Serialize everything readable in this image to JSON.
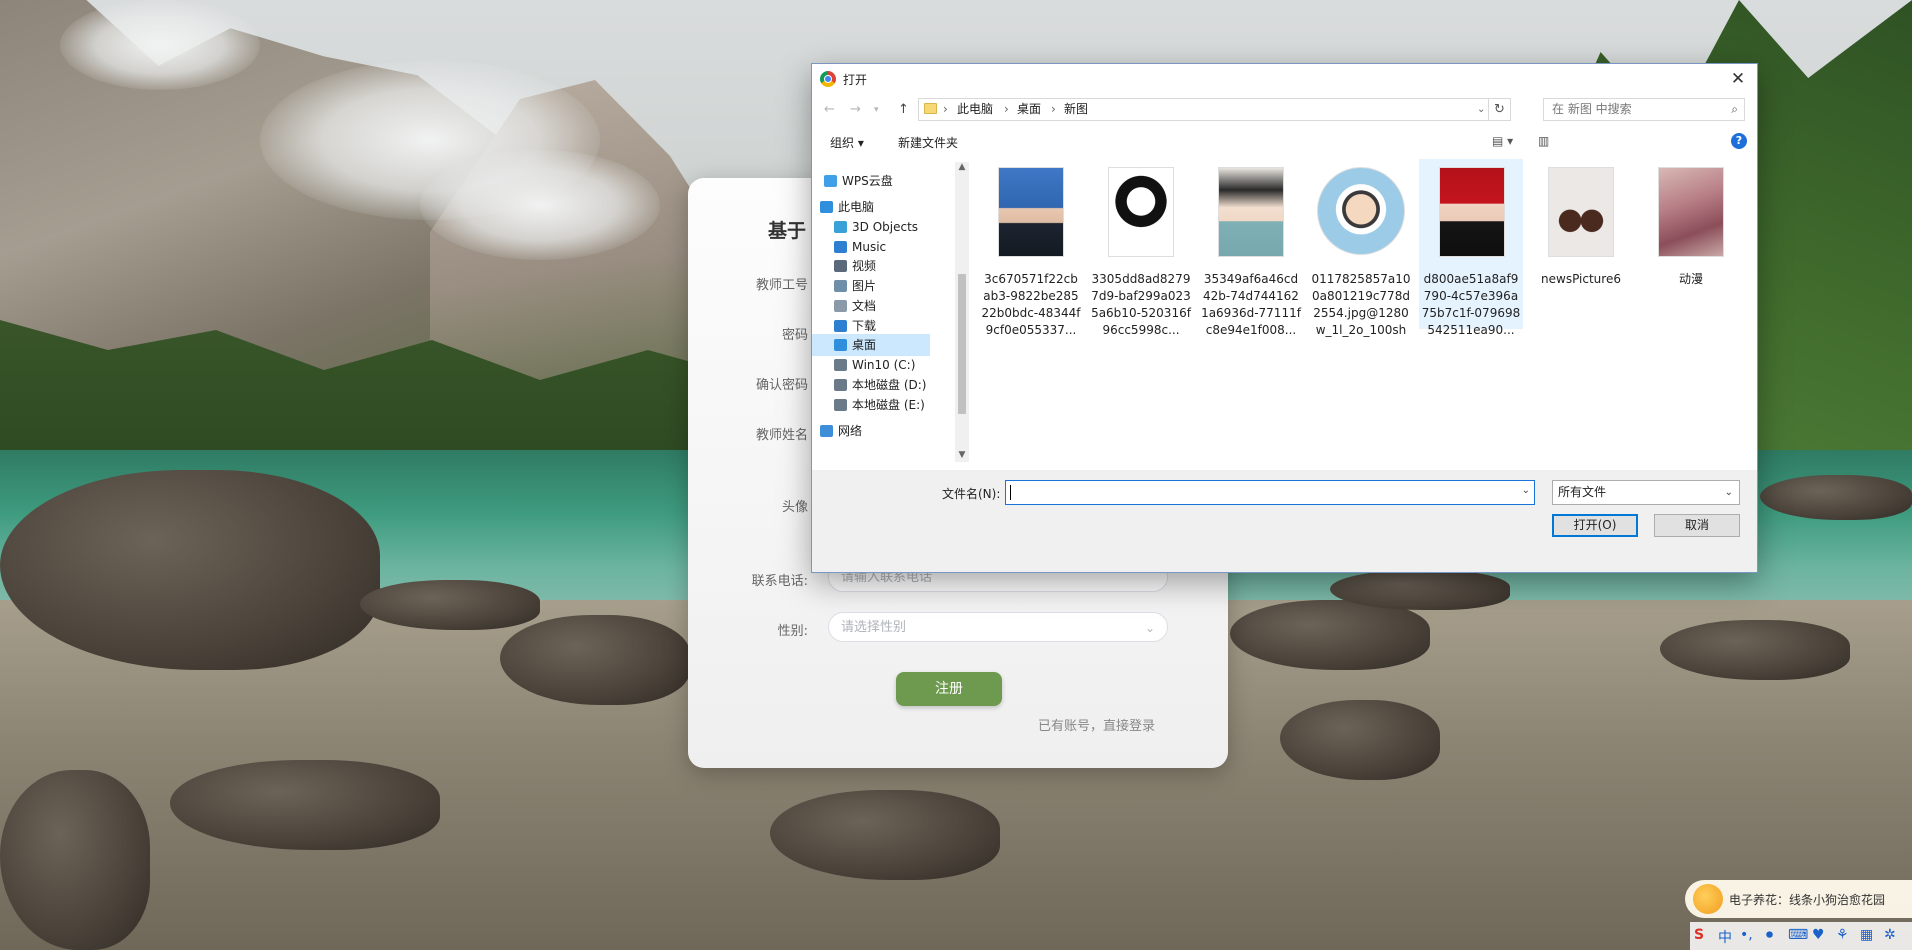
{
  "card": {
    "title": "基于",
    "labels": {
      "teacher_id": "教师工号",
      "password": "密码",
      "confirm_password": "确认密码",
      "teacher_name": "教师姓名",
      "avatar": "头像",
      "phone": "联系电话:",
      "gender": "性别:"
    },
    "phone_placeholder": "请输入联系电话",
    "gender_placeholder": "请选择性别",
    "register_button": "注册",
    "login_link": "已有账号，直接登录"
  },
  "dialog": {
    "title": "打开",
    "breadcrumbs": [
      "此电脑",
      "桌面",
      "新图"
    ],
    "search_placeholder": "在 新图 中搜索",
    "toolbar": {
      "organize": "组织 ▾",
      "new_folder": "新建文件夹"
    },
    "nav_items": [
      {
        "label": "WPS云盘",
        "icon": "cloud-icon",
        "color": "#3fa0e8"
      },
      {
        "label": "此电脑",
        "icon": "computer-icon",
        "color": "#2f8fdd"
      },
      {
        "label": "3D Objects",
        "icon": "cube-icon",
        "color": "#39a0d8"
      },
      {
        "label": "Music",
        "icon": "music-icon",
        "color": "#2f7fd0"
      },
      {
        "label": "视频",
        "icon": "video-icon",
        "color": "#5b6a7a"
      },
      {
        "label": "图片",
        "icon": "picture-icon",
        "color": "#6f8ea8"
      },
      {
        "label": "文档",
        "icon": "document-icon",
        "color": "#8a9aa8"
      },
      {
        "label": "下载",
        "icon": "download-icon",
        "color": "#2f7fd0"
      },
      {
        "label": "桌面",
        "icon": "desktop-icon",
        "color": "#2f8fdd"
      },
      {
        "label": "Win10 (C:)",
        "icon": "drive-c-icon",
        "color": "#6a7a88"
      },
      {
        "label": "本地磁盘 (D:)",
        "icon": "drive-d-icon",
        "color": "#6a7a88"
      },
      {
        "label": "本地磁盘 (E:)",
        "icon": "drive-e-icon",
        "color": "#6a7a88"
      },
      {
        "label": "网络",
        "icon": "network-icon",
        "color": "#3f8fd8"
      }
    ],
    "selected_nav": "桌面",
    "files": [
      {
        "name": "3c670571f22cbab3-9822be28522b0bdc-48344f9cf0e055337...",
        "thumb": "portrait-blue"
      },
      {
        "name": "3305dd8ad82797d9-baf299a0235a6b10-520316f96cc5998c...",
        "thumb": "sketch-mask"
      },
      {
        "name": "35349af6a46cd42b-74d7441621a6936d-77111fc8e94e1f008...",
        "thumb": "anime-boy"
      },
      {
        "name": "0117825857a100a801219c778d2554.jpg@1280w_1l_2o_100sh",
        "thumb": "cartoon-doctor"
      },
      {
        "name": "d800ae51a8af9790-4c57e396a75b7c1f-079698542511ea90...",
        "thumb": "portrait-red"
      },
      {
        "name": "newsPicture6",
        "thumb": "cups"
      },
      {
        "name": "动漫",
        "thumb": "anime-art"
      }
    ],
    "filename_label": "文件名(N):",
    "filename_value": "",
    "filetype": "所有文件",
    "open_button": "打开(O)",
    "cancel_button": "取消"
  },
  "notification": {
    "text": "电子养花：线条小狗治愈花园"
  },
  "tray": {
    "ime": "中"
  }
}
